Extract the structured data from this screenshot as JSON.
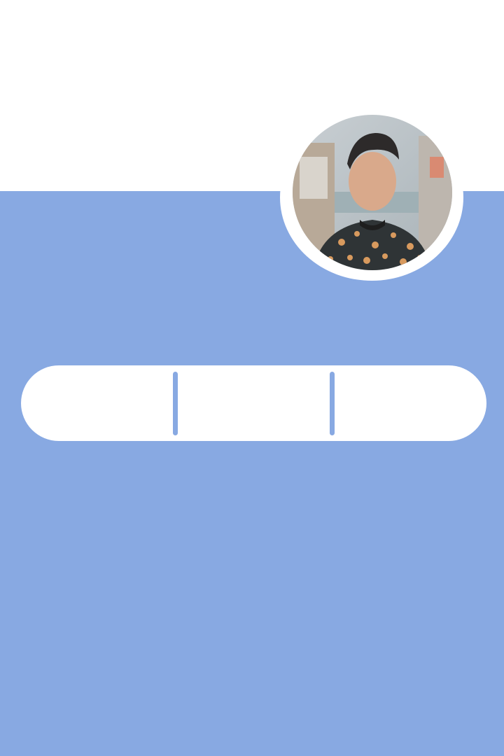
{
  "theme": {
    "accent": "#88a9e2",
    "background": "#ffffff"
  },
  "profile": {
    "avatar_icon": "profile-photo"
  },
  "stats": [
    {
      "value": "",
      "label": ""
    },
    {
      "value": "",
      "label": ""
    },
    {
      "value": "",
      "label": ""
    }
  ]
}
